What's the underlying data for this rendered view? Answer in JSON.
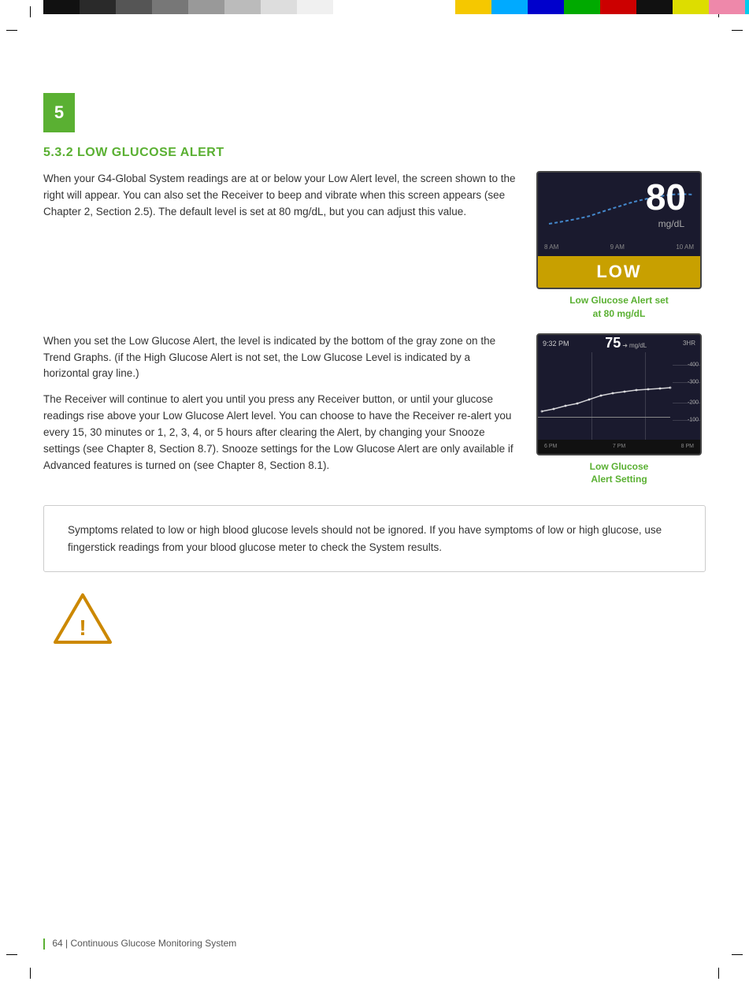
{
  "page": {
    "chapter_number": "5",
    "section_title": "5.3.2  LOW GLUCOSE ALERT",
    "paragraph1": "When your G4-Global System readings are at or below your Low Alert level, the screen shown to the right will appear. You can also set the Receiver to beep and vibrate when this screen appears (see Chapter 2, Section 2.5). The default level is set at 80 mg/dL, but you can adjust this value.",
    "paragraph2": "When you set the Low Glucose Alert, the level is indicated by the bottom of the gray zone on the Trend Graphs. (if the High Glucose Alert is not set, the Low Glucose Level is indicated by a horizontal gray line.)",
    "paragraph3": "The Receiver will continue to alert you until you press any Receiver button, or until your glucose readings rise above your Low Glucose Alert level. You can choose to have the Receiver re-alert you every 15, 30 minutes or 1, 2, 3, 4, or 5 hours after clearing the Alert, by changing your Snooze settings (see Chapter 8, Section 8.7). Snooze settings for the Low Glucose Alert are only available if Advanced features is turned on (see Chapter 8, Section 8.1).",
    "caption1_line1": "Low Glucose Alert set",
    "caption1_line2": "at 80 mg/dL",
    "caption2_line1": "Low Glucose",
    "caption2_line2": "Alert Setting",
    "device1": {
      "number": "80",
      "unit": "mg/dL",
      "low_label": "LOW",
      "time_labels": [
        "8 AM",
        "9 AM",
        "10 AM"
      ]
    },
    "device2": {
      "time": "9:32 PM",
      "value": "75",
      "unit": "mg/dL",
      "mode": "3HR",
      "grid_labels": [
        "-400",
        "-300",
        "-200",
        "-100"
      ],
      "time_labels": [
        "6 PM",
        "7 PM",
        "8 PM"
      ]
    },
    "notice": {
      "text": "Symptoms related to low or high blood glucose levels should not be ignored. If you have symptoms of low or high glucose, use fingerstick readings from your blood glucose meter to check the System results."
    },
    "footer": {
      "page_number": "64",
      "text": "Continuous Glucose Monitoring System"
    }
  },
  "color_bars": {
    "left": [
      "#000000",
      "#1a1a1a",
      "#404040",
      "#666666",
      "#888888",
      "#aaaaaa",
      "#cccccc",
      "#eeeeee"
    ],
    "right": [
      "#f5c800",
      "#00aaff",
      "#0000cc",
      "#00aa00",
      "#cc0000",
      "#000000",
      "#dddd00",
      "#ee88aa",
      "#00ccee"
    ]
  }
}
